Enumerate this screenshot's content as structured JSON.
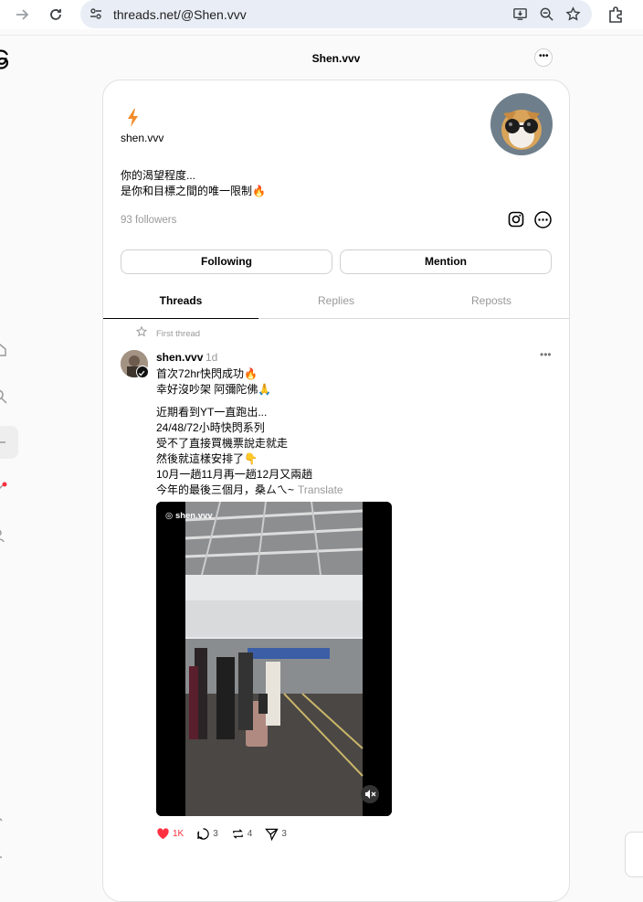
{
  "browser": {
    "url": "threads.net/@Shen.vvv"
  },
  "header": {
    "title": "Shen.vvv"
  },
  "profile": {
    "username": "shen.vvv",
    "bio_lines": [
      "你的渴望程度...",
      "是你和目標之間的唯一限制🔥"
    ],
    "followers": "93 followers",
    "follow_button": "Following",
    "mention_button": "Mention"
  },
  "tabs": [
    {
      "label": "Threads",
      "active": true
    },
    {
      "label": "Replies",
      "active": false
    },
    {
      "label": "Reposts",
      "active": false
    }
  ],
  "post": {
    "pinned_label": "First thread",
    "user": "shen.vvv",
    "time": "1d",
    "para1": [
      "首次72hr快閃成功🔥",
      "幸好沒吵架 阿彌陀佛🙏"
    ],
    "para2": [
      "近期看到YT一直跑出...",
      "24/48/72小時快閃系列",
      "受不了直接買機票說走就走",
      "然後就這樣安排了👇",
      "10月一趟11月再一趟12月又兩趟"
    ],
    "last_line": "今年的最後三個月，桑ㄙㄟ~",
    "translate_label": "Translate",
    "video_handle": "shen.vvv",
    "likes": "1K",
    "replies": "3",
    "reposts": "4",
    "shares": "3"
  },
  "colors": {
    "like": "#ff3040",
    "bolt": "#f28b2a"
  }
}
